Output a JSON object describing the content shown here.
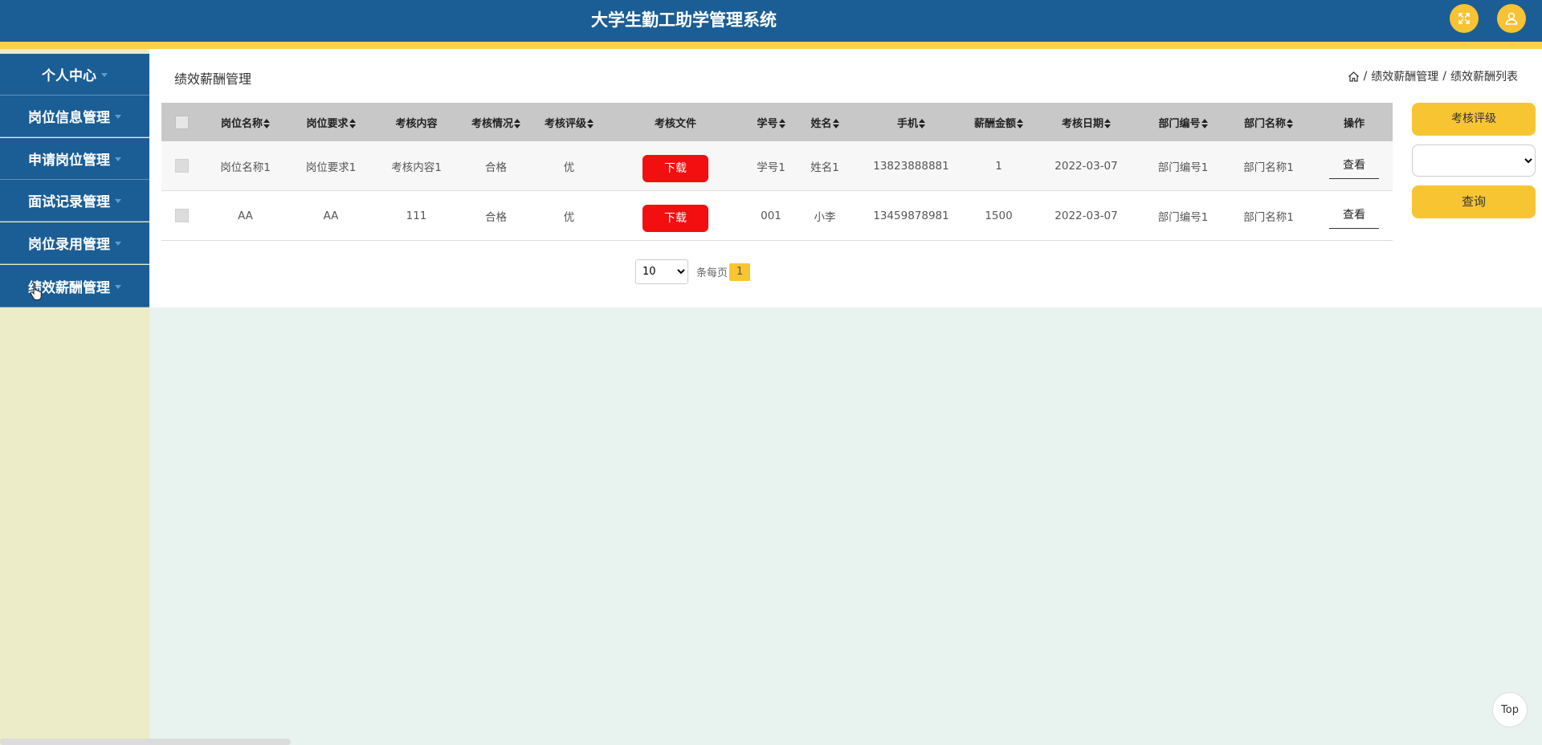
{
  "header": {
    "title": "大学生勤工助学管理系统",
    "accent_color": "#f8c532",
    "bar_color": "#1b5e96",
    "buttons": [
      {
        "icon": "fullscreen-icon"
      },
      {
        "icon": "user-icon"
      }
    ]
  },
  "sidebar": {
    "items": [
      {
        "label": "个人中心"
      },
      {
        "label": "岗位信息管理"
      },
      {
        "label": "申请岗位管理"
      },
      {
        "label": "面试记录管理"
      },
      {
        "label": "岗位录用管理"
      },
      {
        "label": "绩效薪酬管理"
      }
    ]
  },
  "main": {
    "page_title": "绩效薪酬管理",
    "breadcrumb": {
      "home_icon": "home-icon",
      "level1": "绩效薪酬管理",
      "level2": "绩效薪酬列表",
      "separator": "/"
    },
    "table": {
      "columns": [
        "岗位名称",
        "岗位要求",
        "考核内容",
        "考核情况",
        "考核评级",
        "考核文件",
        "学号",
        "姓名",
        "手机",
        "薪酬金额",
        "考核日期",
        "部门编号",
        "部门名称",
        "操作"
      ],
      "rows": [
        {
          "name": "岗位名称1",
          "req": "岗位要求1",
          "content": "考核内容1",
          "status": "合格",
          "grade": "优",
          "file_btn": "下载",
          "sid": "学号1",
          "person": "姓名1",
          "phone": "13823888881",
          "salary": "1",
          "date": "2022-03-07",
          "dept_no": "部门编号1",
          "dept_name": "部门名称1",
          "action": "查看"
        },
        {
          "name": "AA",
          "req": "AA",
          "content": "111",
          "status": "合格",
          "grade": "优",
          "file_btn": "下载",
          "sid": "001",
          "person": "小李",
          "phone": "13459878981",
          "salary": "1500",
          "date": "2022-03-07",
          "dept_no": "部门编号1",
          "dept_name": "部门名称1",
          "action": "查看"
        }
      ]
    },
    "pagination": {
      "page_size": "10",
      "per_page_label": "条每页",
      "current_page": "1"
    }
  },
  "filter": {
    "label": "考核评级",
    "select_value": "",
    "search_label": "查询"
  },
  "back_to_top": "Top"
}
